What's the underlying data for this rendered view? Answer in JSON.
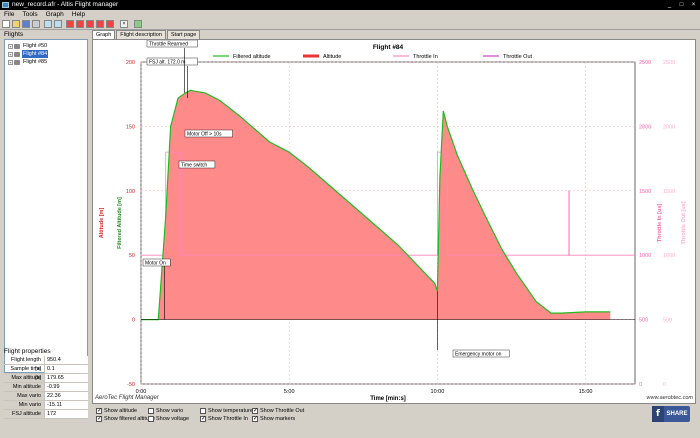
{
  "window": {
    "title": "new_record.afr - Altis Flight manager",
    "controls": [
      "_",
      "□",
      "×"
    ]
  },
  "menu": [
    "File",
    "Tools",
    "Graph",
    "Help"
  ],
  "toolbar_icons": [
    "new-icon",
    "open-icon",
    "save-icon",
    "print-icon",
    "zoom-in-icon",
    "zoom-out-icon",
    "flight-icon-1",
    "flight-icon-2",
    "flight-icon-3",
    "flight-icon-4",
    "flight-icon-5",
    "close-icon",
    "export-icon"
  ],
  "sidebar": {
    "flights_label": "Flights",
    "items": [
      {
        "label": "Flight #50",
        "selected": false
      },
      {
        "label": "Flight #84",
        "selected": true
      },
      {
        "label": "Flight #85",
        "selected": false
      }
    ],
    "properties_label": "Flight properties",
    "properties": [
      {
        "key": "Flight length [s]",
        "value": "950.4"
      },
      {
        "key": "Sample time [s]",
        "value": "0.1"
      },
      {
        "key": "Max altitude",
        "value": "179.65"
      },
      {
        "key": "Min altitude",
        "value": "-0.99"
      },
      {
        "key": "Max vario",
        "value": "22.36"
      },
      {
        "key": "Min vario",
        "value": "-15.11"
      },
      {
        "key": "FSJ altitude",
        "value": "172"
      }
    ]
  },
  "tabs": [
    {
      "label": "Graph",
      "active": true
    },
    {
      "label": "Flight description",
      "active": false
    },
    {
      "label": "Start page",
      "active": false
    }
  ],
  "chart_data": {
    "type": "line",
    "title": "Flight #84",
    "xlabel": "Time [min:s]",
    "ylabel_left": "Altitude [m]",
    "ylabel_left2": "Filtered Altitude [m]",
    "ylabel_right": "Throttle In [us]",
    "ylabel_right2": "Throttle Out [us]",
    "xlim": [
      0,
      1000
    ],
    "ylim": [
      -50,
      200
    ],
    "ylim_right": [
      0,
      2500
    ],
    "x_ticks": [
      {
        "v": 0,
        "label": "0:00"
      },
      {
        "v": 300,
        "label": "5:00"
      },
      {
        "v": 600,
        "label": "10:00"
      },
      {
        "v": 900,
        "label": "15:00"
      }
    ],
    "y_ticks_left": [
      -50,
      0,
      50,
      100,
      150,
      200
    ],
    "y_ticks_right": [
      0,
      500,
      1000,
      1500,
      2000,
      2500
    ],
    "legend": {
      "placement": "top",
      "items": [
        {
          "name": "Filtered altitude",
          "color": "#22bb22"
        },
        {
          "name": "Altitude",
          "color": "#ee3333"
        },
        {
          "name": "Throttle In",
          "color": "#ff88bb"
        },
        {
          "name": "Throttle Out",
          "color": "#cc44cc"
        }
      ]
    },
    "series": [
      {
        "name": "Altitude",
        "x": [
          0,
          35,
          50,
          60,
          75,
          90,
          100,
          130,
          160,
          200,
          260,
          300,
          340,
          400,
          460,
          520,
          560,
          595,
          600,
          605,
          612,
          620,
          640,
          670,
          700,
          730,
          760,
          800,
          830,
          850,
          900,
          950
        ],
        "y": [
          0,
          0,
          80,
          150,
          172,
          176,
          178,
          176,
          170,
          158,
          138,
          130,
          118,
          98,
          78,
          58,
          42,
          28,
          22,
          110,
          162,
          150,
          128,
          102,
          78,
          55,
          36,
          14,
          5,
          5,
          6,
          6
        ]
      },
      {
        "name": "Filtered altitude",
        "x": [
          0,
          35,
          50,
          60,
          75,
          90,
          100,
          130,
          160,
          200,
          260,
          300,
          340,
          400,
          460,
          520,
          560,
          595,
          600,
          605,
          612,
          620,
          640,
          670,
          700,
          730,
          760,
          800,
          830,
          850,
          900,
          950
        ],
        "y": [
          0,
          0,
          80,
          150,
          172,
          176,
          178,
          176,
          170,
          158,
          138,
          130,
          118,
          98,
          78,
          58,
          42,
          28,
          22,
          110,
          162,
          150,
          128,
          102,
          78,
          55,
          36,
          14,
          5,
          5,
          6,
          6
        ]
      },
      {
        "name": "Throttle In",
        "x": [
          0,
          50,
          50,
          80,
          80,
          600,
          600,
          620,
          620,
          866,
          866,
          867,
          867,
          1000
        ],
        "y": [
          1000,
          1000,
          1800,
          1800,
          1000,
          1000,
          1800,
          1800,
          1000,
          1000,
          1500,
          1500,
          1000,
          1000
        ]
      }
    ],
    "annotations": [
      {
        "label": "Throttle Rearmed",
        "x": 88
      },
      {
        "label": "FSJ alt. 172.0 m",
        "x": 88
      },
      {
        "label": "Motor Off > 10s",
        "x": 88
      },
      {
        "label": "Time switch",
        "x": 80
      },
      {
        "label": "Motor On",
        "x": 48
      },
      {
        "label": "Emergency motor on",
        "x": 600
      }
    ],
    "footer_left": "AeroTec Flight Manager",
    "footer_right": "www.aerobtec.com",
    "grid": true
  },
  "checkboxes": [
    {
      "label": "Show altitude",
      "checked": true
    },
    {
      "label": "Show filtered altitude",
      "checked": true
    },
    {
      "label": "Show vario",
      "checked": false
    },
    {
      "label": "Show voltage",
      "checked": false
    },
    {
      "label": "Show temperature",
      "checked": false
    },
    {
      "label": "Show Throttle In",
      "checked": true
    },
    {
      "label": "Show Throttle Out",
      "checked": true
    },
    {
      "label": "Show markers",
      "checked": true
    }
  ],
  "share_label": "SHARE",
  "share_icon": "facebook-f",
  "colors": {
    "altitude_fill": "#ff8a8a",
    "filtered": "#22bb22",
    "throttle_in": "#ff88bb",
    "axis_left": "#dd2222",
    "axis_right": "#ff66aa"
  }
}
